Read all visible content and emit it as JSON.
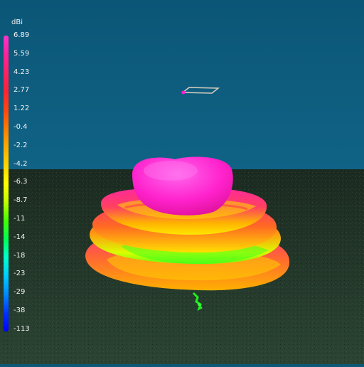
{
  "view": {
    "sky_color": "#0d5878",
    "ground_color": "#22382a"
  },
  "legend": {
    "unit": "dBi",
    "ticks": [
      "6.89",
      "5.59",
      "4.23",
      "2.77",
      "1.22",
      "-0.4",
      "-2.2",
      "-4.2",
      "-6.3",
      "-8.7",
      "-11",
      "-14",
      "-18",
      "-23",
      "-29",
      "-38",
      "-113"
    ],
    "colors": [
      "#ff33cc",
      "#ff2299",
      "#ff2266",
      "#ff2233",
      "#ff4411",
      "#ff7a00",
      "#ffaa00",
      "#ffd400",
      "#ffff00",
      "#bfff00",
      "#44ff00",
      "#00ff55",
      "#00ffcc",
      "#00ccff",
      "#0088ff",
      "#0033ff",
      "#0000ff"
    ]
  }
}
